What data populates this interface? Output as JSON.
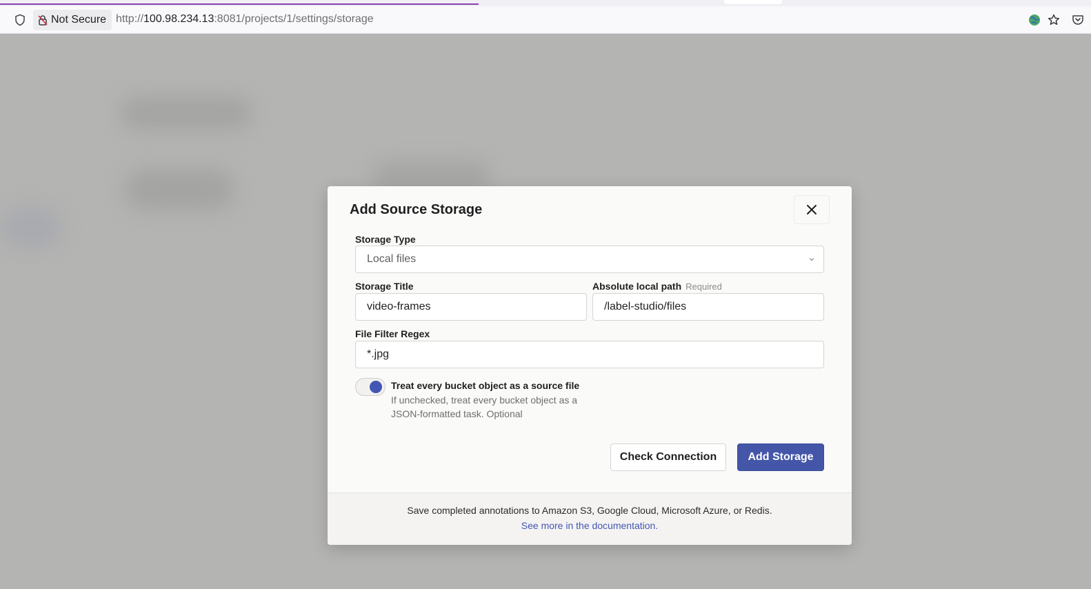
{
  "browser": {
    "security_label": "Not Secure",
    "url_scheme": "http://",
    "url_host": "100.98.234.13",
    "url_rest": ":8081/projects/1/settings/storage"
  },
  "modal": {
    "title": "Add Source Storage",
    "storage_type": {
      "label": "Storage Type",
      "value": "Local files"
    },
    "storage_title": {
      "label": "Storage Title",
      "value": "video-frames"
    },
    "local_path": {
      "label": "Absolute local path",
      "required": "Required",
      "value": "/label-studio/files"
    },
    "file_filter": {
      "label": "File Filter Regex",
      "value": "*.jpg"
    },
    "toggle": {
      "title": "Treat every bucket object as a source file",
      "description": "If unchecked, treat every bucket object as a JSON-formatted task. Optional",
      "checked": true
    },
    "buttons": {
      "check": "Check Connection",
      "add": "Add Storage"
    },
    "footer": {
      "text": "Save completed annotations to Amazon S3, Google Cloud, Microsoft Azure, or Redis.",
      "link": "See more in the documentation."
    }
  },
  "colors": {
    "primary": "#4456a8",
    "overlay": "#b4b4b2",
    "progress": "#8a3fb0"
  }
}
